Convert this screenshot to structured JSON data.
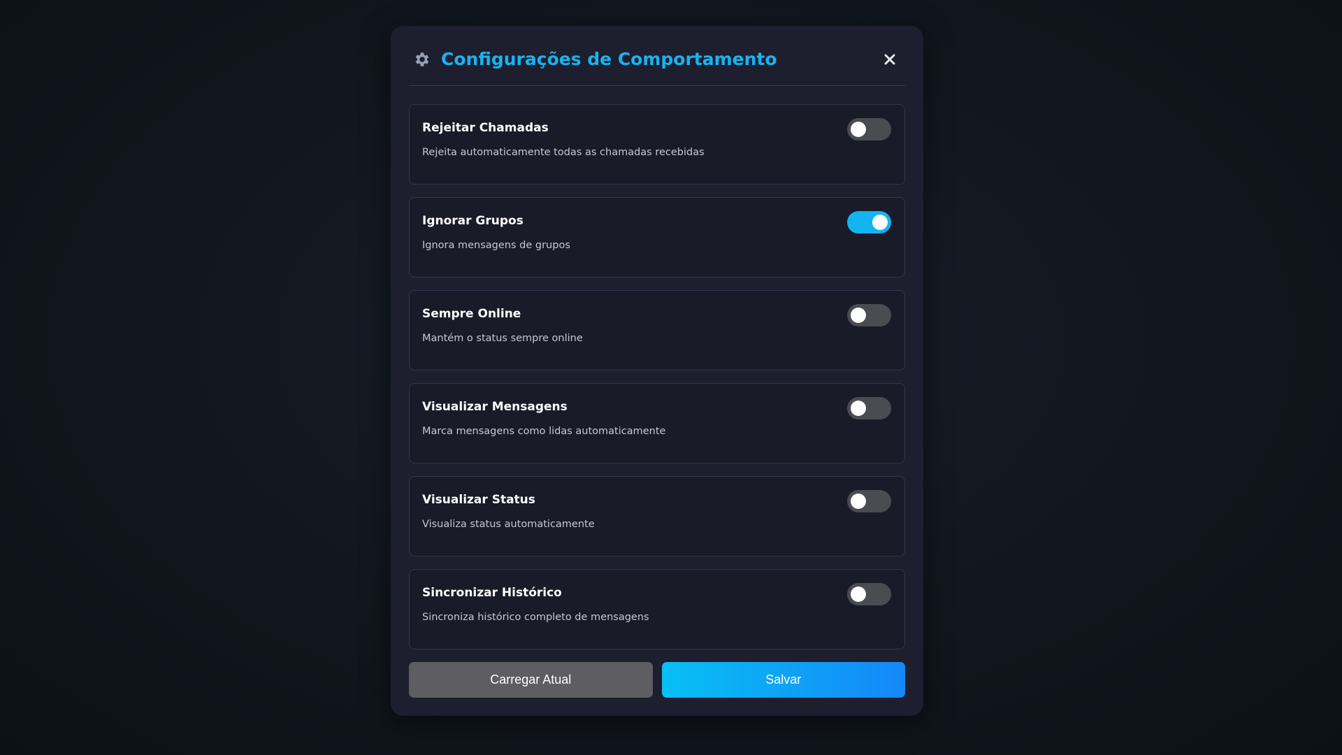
{
  "modal": {
    "title": "Configurações de Comportamento",
    "title_icon": "gear-icon",
    "close_icon": "close-icon",
    "accent_color": "#17b4f0"
  },
  "settings": [
    {
      "title": "Rejeitar Chamadas",
      "description": "Rejeita automaticamente todas as chamadas recebidas",
      "enabled": false
    },
    {
      "title": "Ignorar Grupos",
      "description": "Ignora mensagens de grupos",
      "enabled": true
    },
    {
      "title": "Sempre Online",
      "description": "Mantém o status sempre online",
      "enabled": false
    },
    {
      "title": "Visualizar Mensagens",
      "description": "Marca mensagens como lidas automaticamente",
      "enabled": false
    },
    {
      "title": "Visualizar Status",
      "description": "Visualiza status automaticamente",
      "enabled": false
    },
    {
      "title": "Sincronizar Histórico",
      "description": "Sincroniza histórico completo de mensagens",
      "enabled": false
    }
  ],
  "actions": {
    "load_label": "Carregar Atual",
    "save_label": "Salvar"
  }
}
